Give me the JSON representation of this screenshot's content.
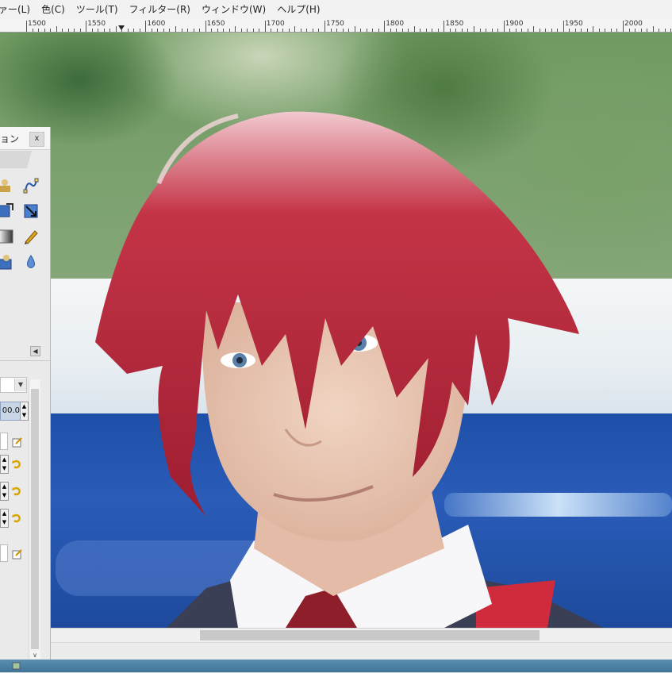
{
  "menubar": {
    "items": [
      "ァー(L)",
      "色(C)",
      "ツール(T)",
      "フィルター(R)",
      "ウィンドウ(W)",
      "ヘルプ(H)"
    ]
  },
  "ruler": {
    "labels": [
      "1500",
      "1550",
      "1600",
      "1650",
      "1700",
      "1750",
      "1800",
      "1850",
      "1900",
      "1950",
      "2000"
    ]
  },
  "dock": {
    "title": "ョン",
    "close": "x",
    "size_value": "00.0",
    "collapse_arrow": "◀",
    "tools": [
      "clone-icon",
      "path-icon",
      "scale-icon",
      "crop-icon",
      "blend-icon",
      "pencil-icon",
      "heal-icon",
      "blur-icon"
    ]
  },
  "colors": {
    "hair": "#b8283a",
    "skin": "#e9c7b2",
    "shirt": "#f6f6f8",
    "blue_wall": "#2456b0",
    "selection": "#c9d6e6"
  }
}
